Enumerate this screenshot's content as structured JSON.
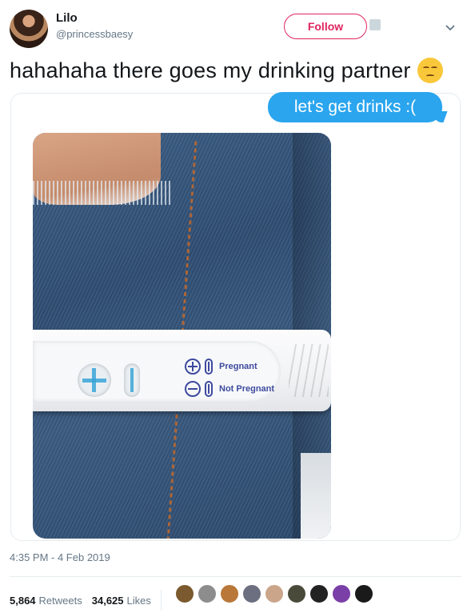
{
  "header": {
    "name": "Lilo",
    "handle": "@princessbaesy",
    "follow_label": "Follow"
  },
  "tweet": {
    "text": "hahahaha there goes my drinking partner",
    "emoji": "pensive-face"
  },
  "media": {
    "message_bubble": "let's get drinks :(",
    "test_labels": {
      "pregnant": "Pregnant",
      "not_pregnant": "Not Pregnant"
    }
  },
  "meta": {
    "timestamp": "4:35 PM - 4 Feb 2019"
  },
  "stats": {
    "retweets_count": "5,864",
    "retweets_label": "Retweets",
    "likes_count": "34,625",
    "likes_label": "Likes"
  },
  "likers": [
    {
      "color": "#7a5a2e"
    },
    {
      "color": "#8d8d8d"
    },
    {
      "color": "#b9773a"
    },
    {
      "color": "#6b6f80"
    },
    {
      "color": "#caa58a"
    },
    {
      "color": "#4a4a3a"
    },
    {
      "color": "#222222"
    },
    {
      "color": "#7b3fa8"
    },
    {
      "color": "#1a1a1a"
    }
  ]
}
